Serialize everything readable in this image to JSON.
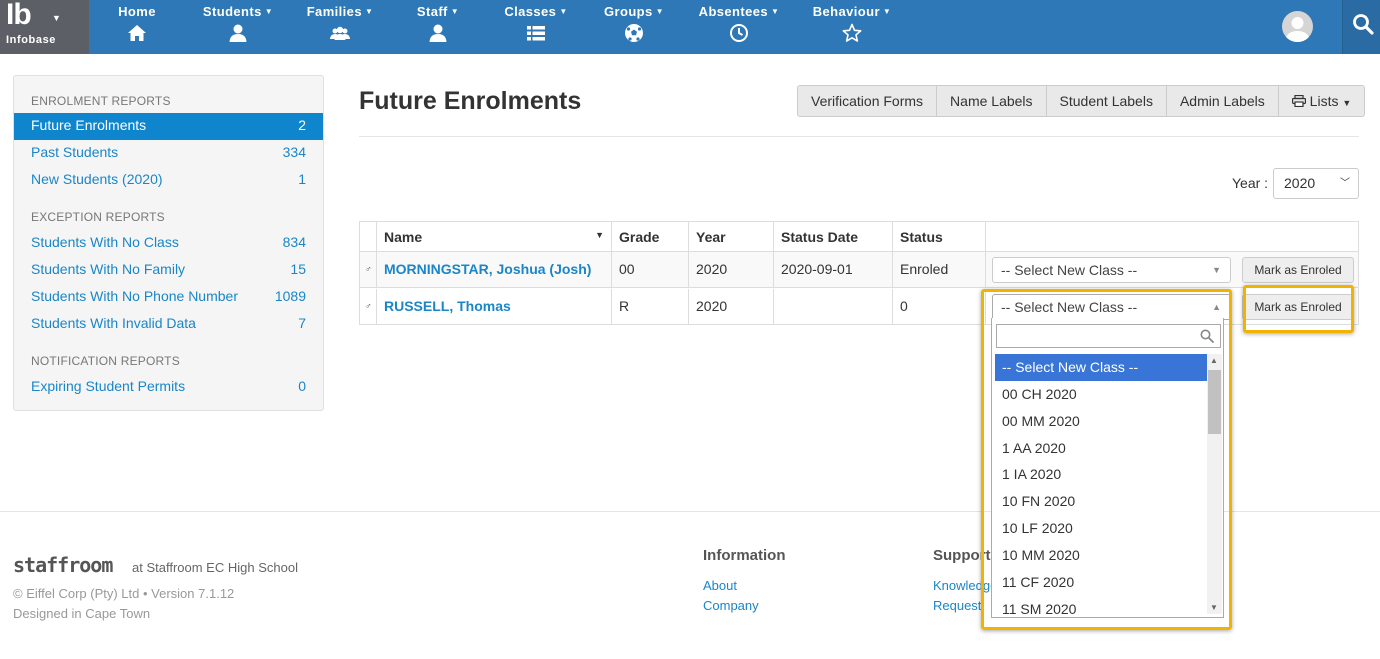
{
  "brand": {
    "logo": "Ib",
    "name": "Infobase"
  },
  "nav": [
    {
      "label": "Home",
      "icon": "home-icon",
      "caret": false
    },
    {
      "label": "Students",
      "icon": "user-icon",
      "caret": true
    },
    {
      "label": "Families",
      "icon": "users-icon",
      "caret": true
    },
    {
      "label": "Staff",
      "icon": "user-icon",
      "caret": true
    },
    {
      "label": "Classes",
      "icon": "list-icon",
      "caret": true
    },
    {
      "label": "Groups",
      "icon": "soccer-ball-icon",
      "caret": true
    },
    {
      "label": "Absentees",
      "icon": "clock-icon",
      "caret": true
    },
    {
      "label": "Behaviour",
      "icon": "star-icon",
      "caret": true
    }
  ],
  "sidebar": {
    "sections": [
      {
        "heading": "ENROLMENT REPORTS"
      },
      {
        "heading": "EXCEPTION REPORTS"
      },
      {
        "heading": "NOTIFICATION REPORTS"
      }
    ],
    "items": [
      {
        "label": "Future Enrolments",
        "count": "2",
        "active": true
      },
      {
        "label": "Past Students",
        "count": "334"
      },
      {
        "label": "New Students (2020)",
        "count": "1"
      },
      {
        "label": "Students With No Class",
        "count": "834"
      },
      {
        "label": "Students With No Family",
        "count": "15"
      },
      {
        "label": "Students With No Phone Number",
        "count": "1089"
      },
      {
        "label": "Students With Invalid Data",
        "count": "7"
      },
      {
        "label": "Expiring Student Permits",
        "count": "0"
      }
    ]
  },
  "main": {
    "title": "Future Enrolments",
    "buttons": [
      "Verification Forms",
      "Name Labels",
      "Student Labels",
      "Admin Labels",
      "Lists"
    ],
    "year_label": "Year :",
    "year_value": "2020"
  },
  "table": {
    "headers": [
      "Name",
      "Grade",
      "Year",
      "Status Date",
      "Status"
    ],
    "rows": [
      {
        "sex": "♂",
        "name": "MORNINGSTAR, Joshua (Josh)",
        "grade": "00",
        "year": "2020",
        "status_date": "2020-09-01",
        "status": "Enroled",
        "select": "-- Select New Class --",
        "action": "Mark as Enroled"
      },
      {
        "sex": "♂",
        "name": "RUSSELL, Thomas",
        "grade": "R",
        "year": "2020",
        "status_date": "",
        "status": "0",
        "select": "-- Select New Class --",
        "action": "Mark as Enroled"
      }
    ]
  },
  "dropdown": {
    "search_value": "",
    "options": [
      "-- Select New Class --",
      "00 CH 2020",
      "00 MM 2020",
      "1 AA 2020",
      "1 IA 2020",
      "10 FN 2020",
      "10 LF 2020",
      "10 MM 2020",
      "11 CF 2020",
      "11 SM 2020"
    ],
    "highlighted_index": 0
  },
  "footer": {
    "logo": "staffroom",
    "at_school": "at Staffroom EC High School",
    "copyright": "© Eiffel Corp (Pty) Ltd • Version 7.1.12",
    "designed": "Designed in Cape Town",
    "info_heading": "Information",
    "info_links": [
      "About",
      "Company"
    ],
    "support_heading": "Support",
    "support_links": [
      "Knowledge",
      "Request"
    ]
  },
  "colors": {
    "navbar": "#2e78b7",
    "brand_bg": "#5c6066",
    "link": "#1a86c8",
    "active": "#0e85cd",
    "highlight_outline": "#f0b400",
    "option_highlight": "#3875d7"
  }
}
